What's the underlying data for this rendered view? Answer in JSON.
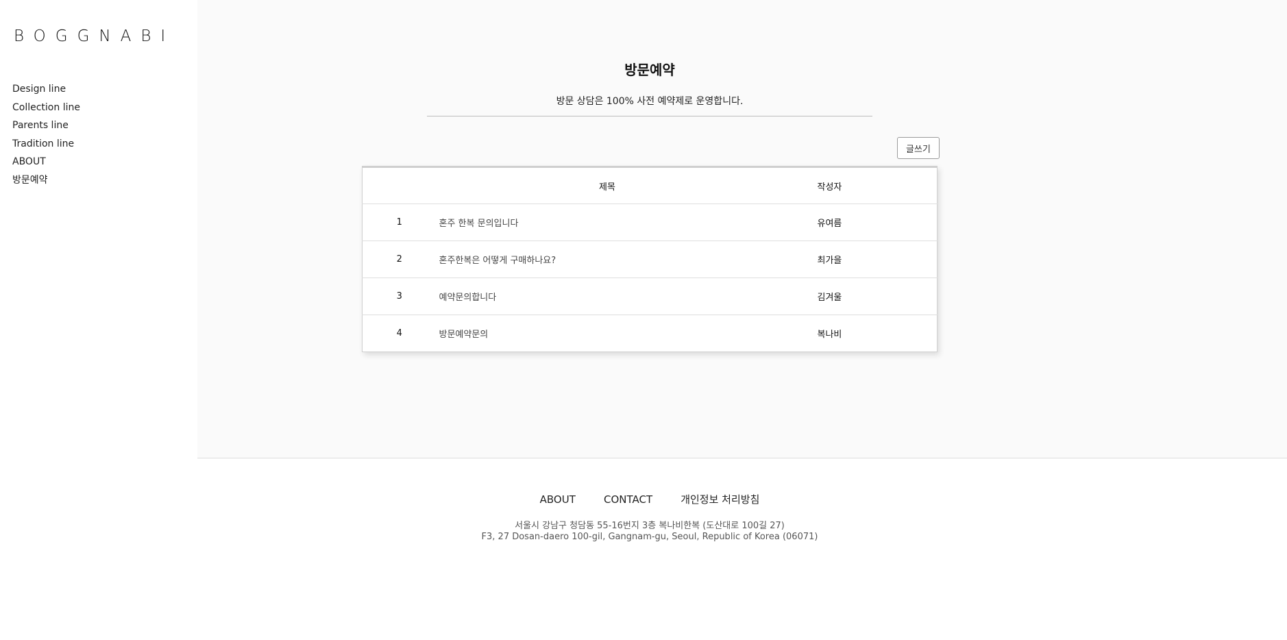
{
  "brand": {
    "logo": "BOGGNABI"
  },
  "sidebar": {
    "items": [
      {
        "label": "Design line"
      },
      {
        "label": "Collection line"
      },
      {
        "label": "Parents line"
      },
      {
        "label": "Tradition line"
      },
      {
        "label": "ABOUT"
      },
      {
        "label": "방문예약"
      }
    ]
  },
  "main": {
    "title": "방문예약",
    "subtitle": "방문 상담은 100% 사전 예약제로 운영합니다.",
    "write_button": "글쓰기",
    "table": {
      "headers": {
        "number": "",
        "title": "제목",
        "author": "작성자"
      },
      "rows": [
        {
          "number": "1",
          "title": "혼주 한복 문의입니다",
          "author": "유여름"
        },
        {
          "number": "2",
          "title": "혼주한복은 어떻게 구매하나요?",
          "author": "최가을"
        },
        {
          "number": "3",
          "title": "예약문의합니다",
          "author": "김겨울"
        },
        {
          "number": "4",
          "title": "방문예약문의",
          "author": "복나비"
        }
      ]
    }
  },
  "footer": {
    "links": [
      {
        "label": "ABOUT"
      },
      {
        "label": "CONTACT"
      },
      {
        "label": "개인정보 처리방침"
      }
    ],
    "address_ko": "서울시 강남구 청담동 55-16번지 3층 복나비한복 (도산대로 100길 27)",
    "address_en": "F3, 27 Dosan-daero 100-gil, Gangnam-gu, Seoul, Republic of Korea (06071)"
  },
  "colors": {
    "main_background": "#fafafa",
    "text": "#222222",
    "border": "#cfcfcf"
  }
}
